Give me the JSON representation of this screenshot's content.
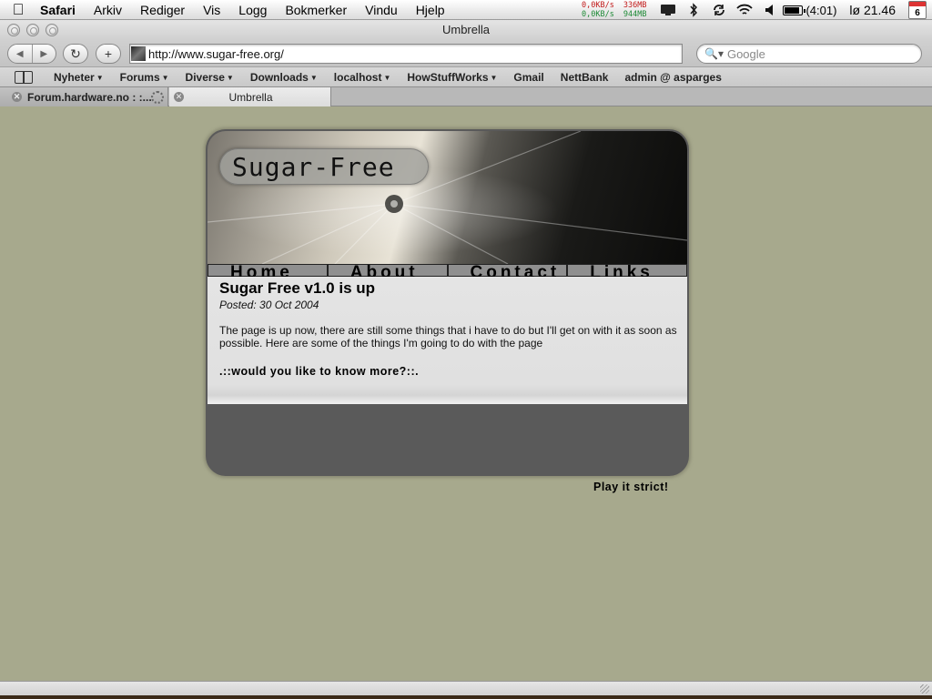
{
  "menubar": {
    "apple_icon": "apple-logo",
    "app_name": "Safari",
    "items": [
      "Arkiv",
      "Rediger",
      "Vis",
      "Logg",
      "Bokmerker",
      "Vindu",
      "Hjelp"
    ],
    "net_up": "0,0KB/s",
    "net_down": "0,0KB/s",
    "mem_used": "336MB",
    "mem_free": "944MB",
    "battery_time": "(4:01)",
    "battery_level": 0.8,
    "clock": "lø 21.46",
    "calendar_day": "6"
  },
  "window": {
    "title": "Umbrella"
  },
  "toolbar": {
    "url": "http://www.sugar-free.org/",
    "search_placeholder": "Google"
  },
  "bookmarks": [
    {
      "label": "Nyheter",
      "menu": true
    },
    {
      "label": "Forums",
      "menu": true
    },
    {
      "label": "Diverse",
      "menu": true
    },
    {
      "label": "Downloads",
      "menu": true
    },
    {
      "label": "localhost",
      "menu": true
    },
    {
      "label": "HowStuffWorks",
      "menu": true
    },
    {
      "label": "Gmail",
      "menu": false
    },
    {
      "label": "NettBank",
      "menu": false
    },
    {
      "label": "admin @ asparges",
      "menu": false
    }
  ],
  "tabs": [
    {
      "label": "Forum.hardware.no : :...",
      "loading": true,
      "active": false
    },
    {
      "label": "Umbrella",
      "loading": false,
      "active": true
    }
  ],
  "site": {
    "logo": "Sugar-Free",
    "nav": [
      "Home",
      "About",
      "Contact",
      "Links"
    ],
    "post": {
      "title": "Sugar Free v1.0 is up",
      "date": "Posted: 30 Oct 2004",
      "body": "The page is up now, there are still some things that i have to do but I'll get on with it as soon as possible. Here are some of the things I'm going to do with the page",
      "more": ".::would you like to know more?::."
    },
    "tagline": "Play it strict!"
  },
  "colors": {
    "page_background": "#a7a98d",
    "site_dark": "#5a5a5a",
    "content_background": "#e0e0e0",
    "nav_background": "#8f8f8f"
  }
}
